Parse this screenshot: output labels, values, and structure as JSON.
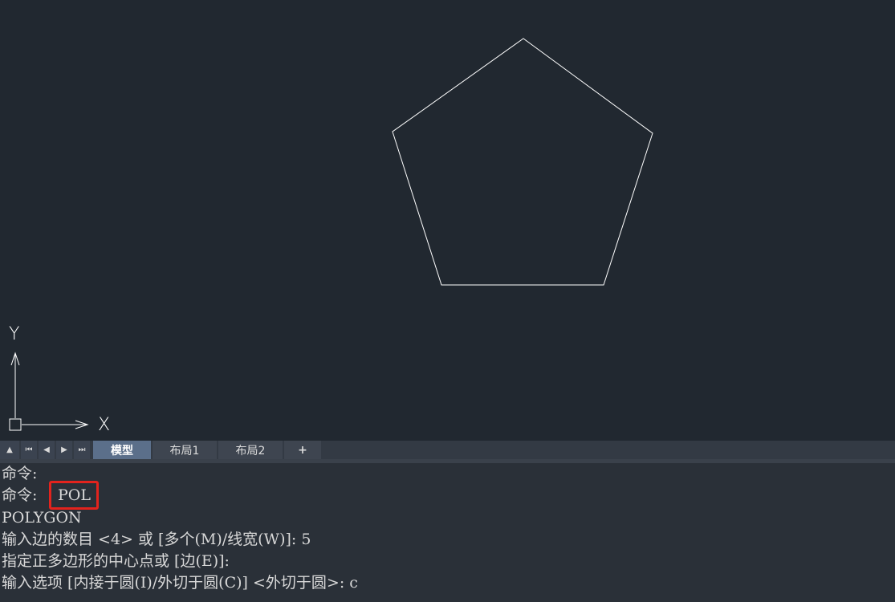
{
  "canvas": {
    "background": "#212830",
    "shape": "pentagon",
    "stroke_color": "#ffffff"
  },
  "ucs": {
    "x_label": "X",
    "y_label": "Y"
  },
  "tabbar": {
    "nav_icons": [
      "triangle-up-icon",
      "first-icon",
      "prev-icon",
      "next-icon",
      "last-icon"
    ],
    "tabs": [
      "模型",
      "布局1",
      "布局2"
    ],
    "active_tab": "模型",
    "add_label": "+"
  },
  "command_history": {
    "lines": [
      "命令:",
      "命令:",
      "POLYGON",
      "输入边的数目 <4> 或 [多个(M)/线宽(W)]: 5",
      "指定正多边形的中心点或 [边(E)]:",
      "输入选项 [内接于圆(I)/外切于圆(C)] <外切于圆>: c"
    ],
    "highlighted_input": "POL",
    "highlight_color": "#e3231d"
  }
}
